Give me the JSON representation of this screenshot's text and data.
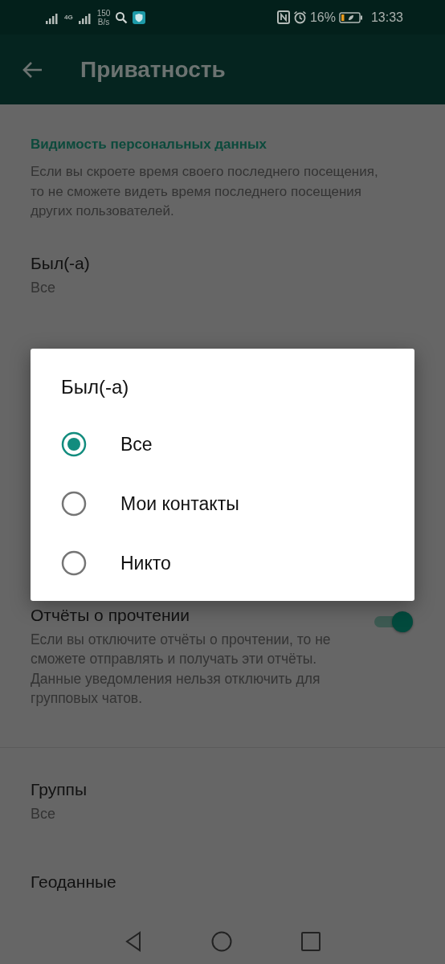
{
  "status_bar": {
    "network": "4G",
    "speed": "150",
    "speed_unit": "B/s",
    "battery": "16%",
    "time": "13:33"
  },
  "app_bar": {
    "title": "Приватность"
  },
  "section": {
    "heading": "Видимость персональных данных",
    "description": "Если вы скроете время своего последнего посещения, то не сможете видеть время последнего посещения других пользователей."
  },
  "last_seen": {
    "title": "Был(-а)",
    "value": "Все"
  },
  "read_receipts": {
    "title": "Отчёты о прочтении",
    "description": "Если вы отключите отчёты о прочтении, то не сможете отправлять и получать эти отчёты. Данные уведомления нельзя отключить для групповых чатов.",
    "on": true
  },
  "items": [
    {
      "title": "Группы",
      "value": "Все"
    },
    {
      "title": "Геоданные"
    }
  ],
  "dialog": {
    "title": "Был(-а)",
    "options": [
      {
        "label": "Все",
        "selected": true
      },
      {
        "label": "Мои контакты",
        "selected": false
      },
      {
        "label": "Никто",
        "selected": false
      }
    ]
  }
}
